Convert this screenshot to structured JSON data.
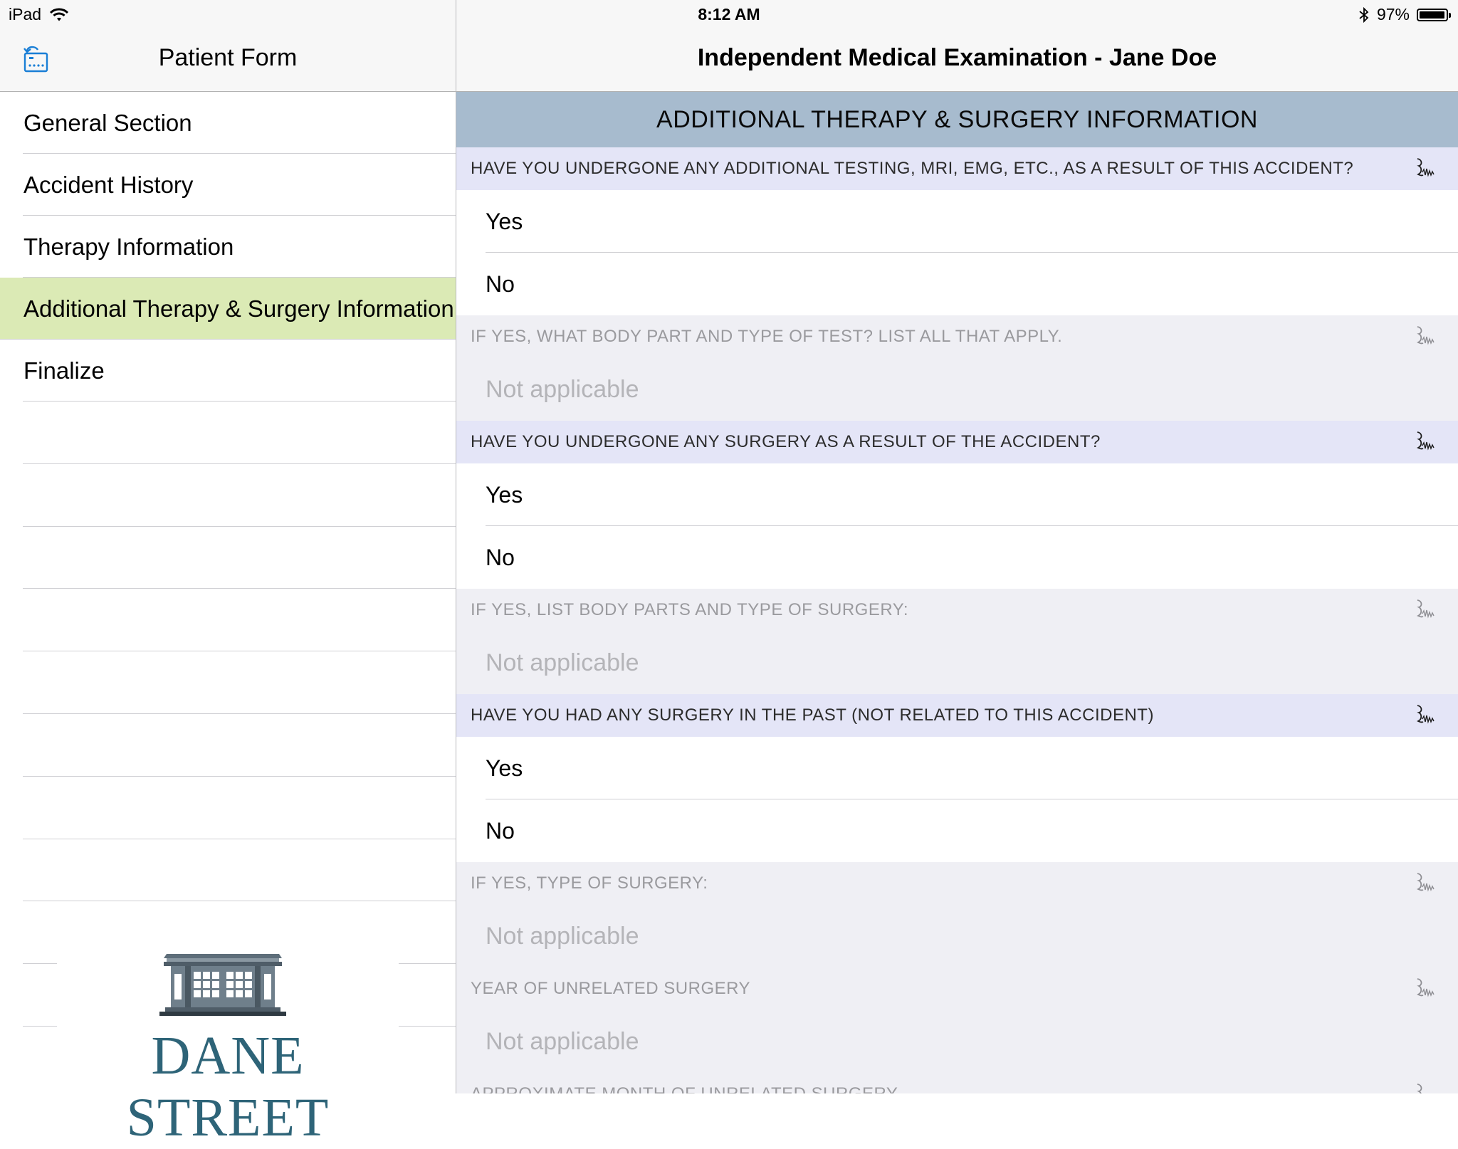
{
  "status_bar": {
    "device": "iPad",
    "time": "8:12 AM",
    "battery": "97%",
    "battery_level": 0.97
  },
  "left_pane": {
    "title": "Patient Form",
    "menu": [
      "General Section",
      "Accident History",
      "Therapy Information",
      "Additional Therapy & Surgery Information",
      "Finalize"
    ],
    "active_index": 3,
    "logo_text": "DANE STREET"
  },
  "right_pane": {
    "title": "Independent Medical Examination - Jane Doe",
    "section_title": "ADDITIONAL THERAPY & SURGERY INFORMATION",
    "questions": [
      {
        "label": "HAVE YOU UNDERGONE ANY ADDITIONAL TESTING, MRI, EMG, ETC., AS A RESULT OF THIS ACCIDENT?",
        "options": [
          "Yes",
          "No"
        ]
      },
      {
        "label": "IF YES, WHAT BODY PART AND TYPE OF TEST? LIST ALL THAT APPLY.",
        "value": "Not applicable"
      },
      {
        "label": "HAVE YOU UNDERGONE ANY SURGERY AS A RESULT OF THE ACCIDENT?",
        "options": [
          "Yes",
          "No"
        ]
      },
      {
        "label": "IF YES, LIST BODY PARTS AND TYPE OF SURGERY:",
        "value": "Not applicable"
      },
      {
        "label": "HAVE YOU HAD ANY SURGERY IN THE PAST (NOT RELATED TO THIS ACCIDENT)",
        "options": [
          "Yes",
          "No"
        ]
      },
      {
        "label": "IF YES, TYPE OF SURGERY:",
        "value": "Not applicable"
      },
      {
        "label": "YEAR OF UNRELATED SURGERY",
        "value": "Not applicable"
      },
      {
        "label": "APPROXIMATE MONTH OF UNRELATED SURGERY"
      }
    ]
  },
  "icons": {
    "back": "form-back-icon",
    "signature": "signature-icon",
    "wifi": "wifi-icon",
    "bluetooth": "bluetooth-icon",
    "battery": "battery-icon"
  },
  "colors": {
    "section_header": "#a7bbce",
    "active_menu": "#dbeab5",
    "active_question": "#e4e5f7",
    "accent_blue": "#1a7fd6",
    "logo": "#2e6478"
  }
}
